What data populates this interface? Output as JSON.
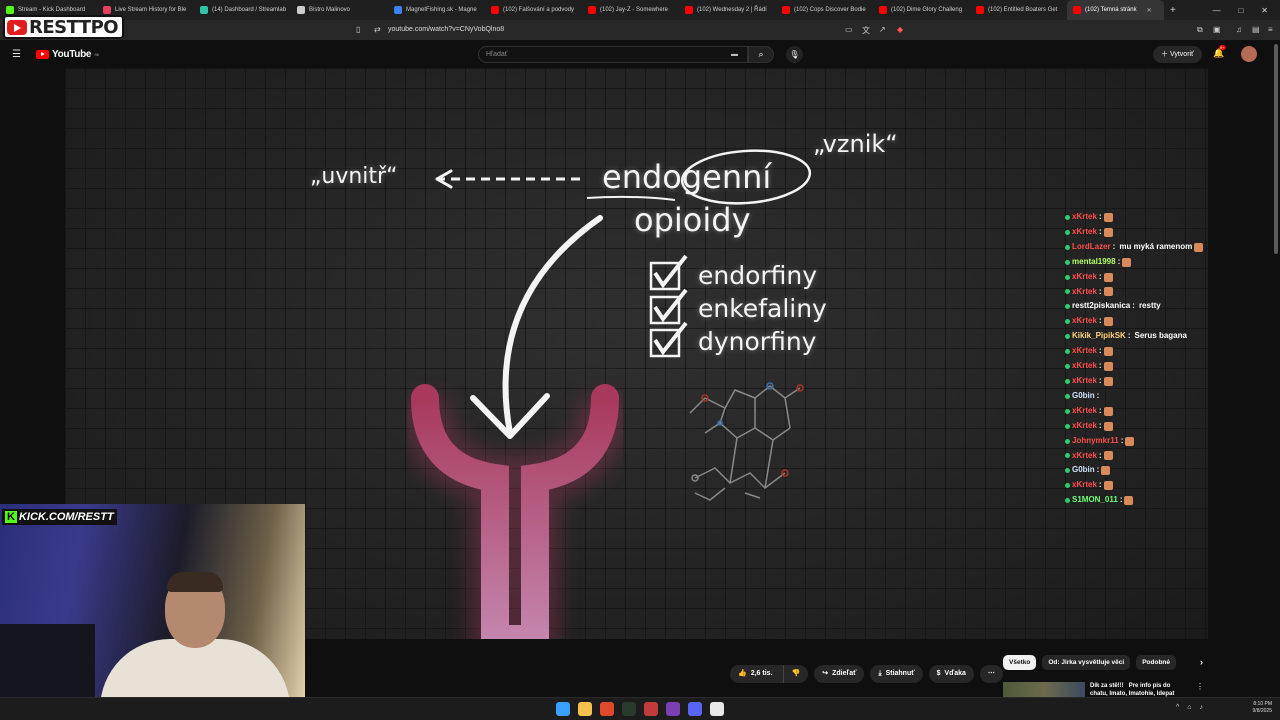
{
  "browser": {
    "tabs": [
      {
        "label": "Stream - Kick Dashboard",
        "color": "#53fc18"
      },
      {
        "label": "Live Stream History for Ble",
        "color": "#e4405f"
      },
      {
        "label": "(14) Dashboard / Streamlab",
        "color": "#31c3a2"
      },
      {
        "label": "Bistro Malinovo",
        "color": "#cccccc"
      },
      {
        "label": "MagnetFishing.sk - Magne",
        "color": "#3b82f6"
      },
      {
        "label": "(102) Falšování a podvody",
        "color": "#ff0000"
      },
      {
        "label": "(102) Jay-Z - Somewhere",
        "color": "#ff0000"
      },
      {
        "label": "(102) Wednesday 2 | Řádí",
        "color": "#ff0000"
      },
      {
        "label": "(102) Cops Discover Bodie",
        "color": "#ff0000"
      },
      {
        "label": "(102) Dime Glory Challeng",
        "color": "#ff0000"
      },
      {
        "label": "(102) Entitled Boaters Get",
        "color": "#ff0000"
      },
      {
        "label": "(102) Temná stránk",
        "color": "#ff0000",
        "active": true
      }
    ],
    "url": "youtube.com/watch?v=CNyVobQlno8"
  },
  "youtube": {
    "logo_text": "YouTube",
    "logo_region": "SK",
    "search_placeholder": "Hľadať",
    "create_label": "Vytvoriť",
    "notif_badge": "9+"
  },
  "video_overlay": {
    "word_main": "endogenní",
    "word_sub": "opioidy",
    "label_left": "„uvnitř“",
    "label_right": "„vznik“",
    "checklist": [
      "endorfiny",
      "enkefaliny",
      "dynorfiny"
    ]
  },
  "chat": [
    {
      "user": "xKrtek",
      "msg": "",
      "color": "#ff4d4d",
      "emote": true
    },
    {
      "user": "xKrtek",
      "msg": "",
      "color": "#ff4d4d",
      "emote": true
    },
    {
      "user": "LordLazer",
      "msg": "mu myká ramenom",
      "color": "#ff4d4d",
      "emote": true
    },
    {
      "user": "mental1998",
      "msg": "",
      "color": "#b7ff66",
      "emote": true
    },
    {
      "user": "xKrtek",
      "msg": "",
      "color": "#ff4d4d",
      "emote": true
    },
    {
      "user": "xKrtek",
      "msg": "",
      "color": "#ff4d4d",
      "emote": true
    },
    {
      "user": "restt2piskanica",
      "msg": "restty",
      "color": "#ffffff",
      "emote": false
    },
    {
      "user": "xKrtek",
      "msg": "",
      "color": "#ff4d4d",
      "emote": true
    },
    {
      "user": "Kikik_PipikSK",
      "msg": "Serus bagana",
      "color": "#ffd37a",
      "emote": false
    },
    {
      "user": "xKrtek",
      "msg": "",
      "color": "#ff4d4d",
      "emote": true
    },
    {
      "user": "xKrtek",
      "msg": "",
      "color": "#ff4d4d",
      "emote": true
    },
    {
      "user": "xKrtek",
      "msg": "",
      "color": "#ff4d4d",
      "emote": true
    },
    {
      "user": "G0bin",
      "msg": "",
      "color": "#cfe3ff",
      "emote": false
    },
    {
      "user": "xKrtek",
      "msg": "",
      "color": "#ff4d4d",
      "emote": true
    },
    {
      "user": "xKrtek",
      "msg": "",
      "color": "#ff4d4d",
      "emote": true
    },
    {
      "user": "Johnymkr11",
      "msg": "",
      "color": "#ff4d4d",
      "emote": true
    },
    {
      "user": "xKrtek",
      "msg": "",
      "color": "#ff4d4d",
      "emote": true
    },
    {
      "user": "G0bin",
      "msg": "",
      "color": "#cfe3ff",
      "emote": true
    },
    {
      "user": "xKrtek",
      "msg": "",
      "color": "#ff4d4d",
      "emote": true
    },
    {
      "user": "S1MON_011",
      "msg": "",
      "color": "#6dff7a",
      "emote": true
    }
  ],
  "overlay": {
    "brand_text": "RESTTPO",
    "kick_text": "KICK.COM/RESTT"
  },
  "actions": {
    "likes": "2,6 tis.",
    "share": "Zdieľať",
    "download": "Stiahnuť",
    "thanks": "Vďaka",
    "more": "⋯"
  },
  "chips": [
    "Všetko",
    "Od: Jirka vysvětluje věci",
    "Podobné"
  ],
  "side_card": {
    "title_a": "Dík za stě!!!",
    "title_b": "Pre info pis do",
    "title_c": "chatu, Imato, Imatohie, Idepat"
  },
  "tray": {
    "time": "8:10 PM",
    "date": "9/8/2025"
  }
}
